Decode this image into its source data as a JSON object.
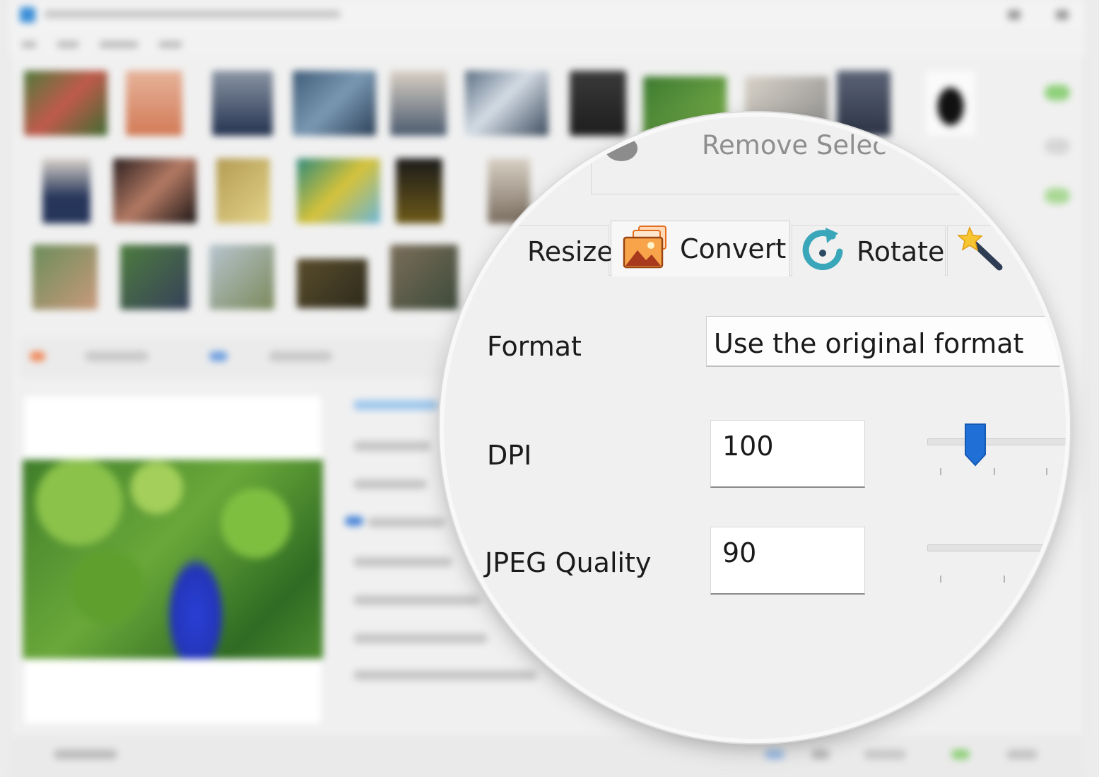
{
  "tabs": {
    "resize_label": "Resize",
    "convert_label": "Convert",
    "rotate_label": "Rotate",
    "active": "Convert"
  },
  "toolbar": {
    "remove_selected_label": "Remove Selec"
  },
  "convert_panel": {
    "format_label": "Format",
    "format_value": "Use the original format",
    "dpi_label": "DPI",
    "dpi_value": "100",
    "dpi_slider_level": 0.25,
    "jpeg_quality_label": "JPEG Quality",
    "jpeg_quality_value": "90"
  },
  "icons": {
    "remove": "gear-icon",
    "convert": "images-stack-icon",
    "rotate": "rotate-icon",
    "effects": "magic-wand-icon"
  },
  "colors": {
    "accent_blue": "#1f6fd6",
    "rotate_teal": "#3aa6b9",
    "convert_orange": "#f07a25"
  }
}
